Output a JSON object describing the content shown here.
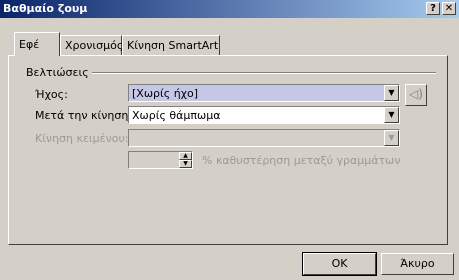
{
  "window": {
    "title": "Βαθμαίο ζουμ",
    "help_glyph": "?",
    "close_glyph": "✕"
  },
  "tabs": [
    {
      "label": "Εφέ",
      "active": true
    },
    {
      "label": "Χρονισμός",
      "active": false
    },
    {
      "label": "Κίνηση SmartArt",
      "active": false
    }
  ],
  "group": {
    "label": "Βελτιώσεις"
  },
  "fields": {
    "sound": {
      "label": "Ήχος:",
      "value": "[Χωρίς ήχο]"
    },
    "after_animation": {
      "label": "Μετά την κίνηση:",
      "value": "Χωρίς θάμπωμα"
    },
    "animate_text": {
      "label": "Κίνηση κειμένου:",
      "value": ""
    },
    "delay": {
      "value": "",
      "suffix": "% καθυστέρηση μεταξύ γραμμάτων"
    }
  },
  "icons": {
    "dropdown": "chevron-down-icon",
    "speaker": "speaker-icon",
    "spin_up": "spin-up-icon",
    "spin_down": "spin-down-icon"
  },
  "buttons": {
    "ok": "OK",
    "cancel": "Άκυρο"
  }
}
